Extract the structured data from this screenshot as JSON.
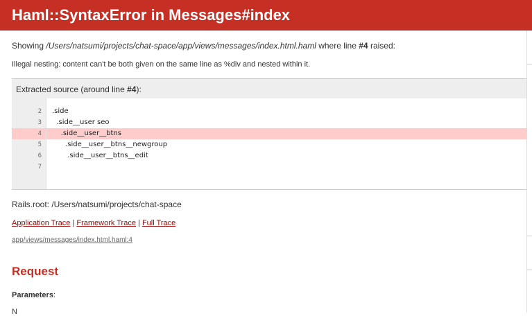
{
  "header": {
    "title": "Haml::SyntaxError in Messages#index"
  },
  "showing": {
    "prefix": "Showing ",
    "path": "/Users/natsumi/projects/chat-space/app/views/messages/index.html.haml",
    "middle": " where line ",
    "line": "#4",
    "suffix": " raised:"
  },
  "error_message": "Illegal nesting: content can't be both given on the same line as %div and nested within it.",
  "extracted_source": {
    "title_prefix": "Extracted source (around line ",
    "title_line": "#4",
    "title_suffix": "):",
    "line_numbers": [
      "2",
      "3",
      "4",
      "5",
      "6",
      "7"
    ],
    "lines": [
      ".side",
      "  .side__user seo",
      "    .side__user__btns",
      "      .side__user__btns__newgroup",
      "       .side__user__btns__edit",
      ""
    ],
    "highlight_index": 2
  },
  "rails_root": "Rails.root: /Users/natsumi/projects/chat-space",
  "traces": {
    "application": "Application Trace",
    "framework": "Framework Trace",
    "full": "Full Trace",
    "separator": "|"
  },
  "trace_entry": "app/views/messages/index.html.haml:4",
  "request": {
    "title": "Request",
    "parameters_label": "Parameters",
    "parameters_colon": ":",
    "cutoff_text": "N"
  },
  "colors": {
    "header_bg": "#c52f24",
    "highlight": "#ffcccc",
    "link": "#980905"
  }
}
